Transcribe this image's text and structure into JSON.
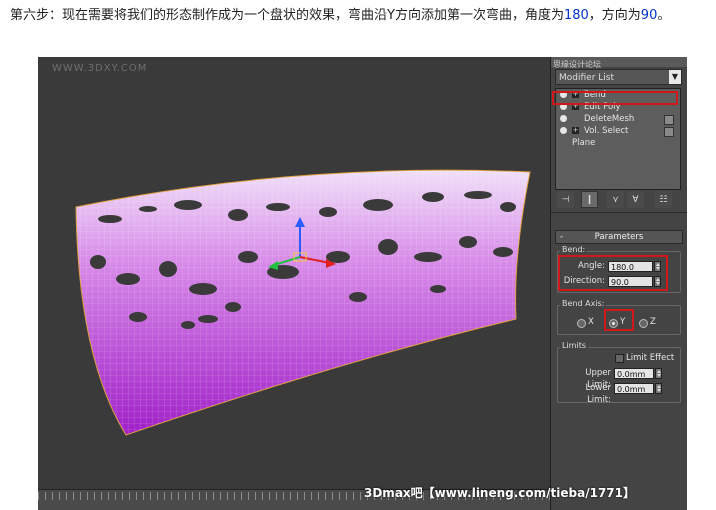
{
  "caption": {
    "text_before": "第六步：现在需要将我们的形态制作成为一个盘状的效果，弯曲沿Y方向添加第一次弯曲，角度为",
    "angle_highlight": "180",
    "text_mid": "，方向为",
    "direction_highlight": "90",
    "text_end": "。"
  },
  "viewport": {
    "watermark": "WWW.3DXY.COM"
  },
  "command_panel": {
    "corner_watermark": "思缘设计论坛",
    "modifier_list_label": "Modifier List",
    "stack": [
      {
        "label": "Bend",
        "has_bulb": true,
        "has_plus": true,
        "has_check": false,
        "highlighted": true
      },
      {
        "label": "Edit Poly",
        "has_bulb": true,
        "has_plus": true,
        "has_check": false
      },
      {
        "label": "DeleteMesh",
        "has_bulb": true,
        "has_plus": false,
        "has_check": true
      },
      {
        "label": "Vol. Select",
        "has_bulb": true,
        "has_plus": true,
        "has_check": true
      },
      {
        "label": "Plane",
        "has_bulb": false,
        "has_plus": false,
        "has_check": false
      }
    ],
    "parameters": {
      "rollout_title": "Parameters",
      "minus": "-",
      "bend_group": "Bend:",
      "angle_label": "Angle:",
      "angle_value": "180.0",
      "direction_label": "Direction:",
      "direction_value": "90.0",
      "bend_axis_group": "Bend Axis:",
      "axis_x": "X",
      "axis_y": "Y",
      "axis_z": "Z",
      "axis_selected": "Y",
      "limits_group": "Limits",
      "limit_effect": "Limit Effect",
      "upper_limit_label": "Upper Limit:",
      "upper_limit_value": "0.0mm",
      "lower_limit_label": "Lower Limit:",
      "lower_limit_value": "0.0mm"
    }
  },
  "footer_watermark": "3Dmax吧【www.lineng.com/tieba/1771】",
  "colors": {
    "highlight_red": "#d01818",
    "mesh_purple": "#c040d8",
    "panel_bg": "#444444",
    "caption_highlight": "#0033cc"
  }
}
